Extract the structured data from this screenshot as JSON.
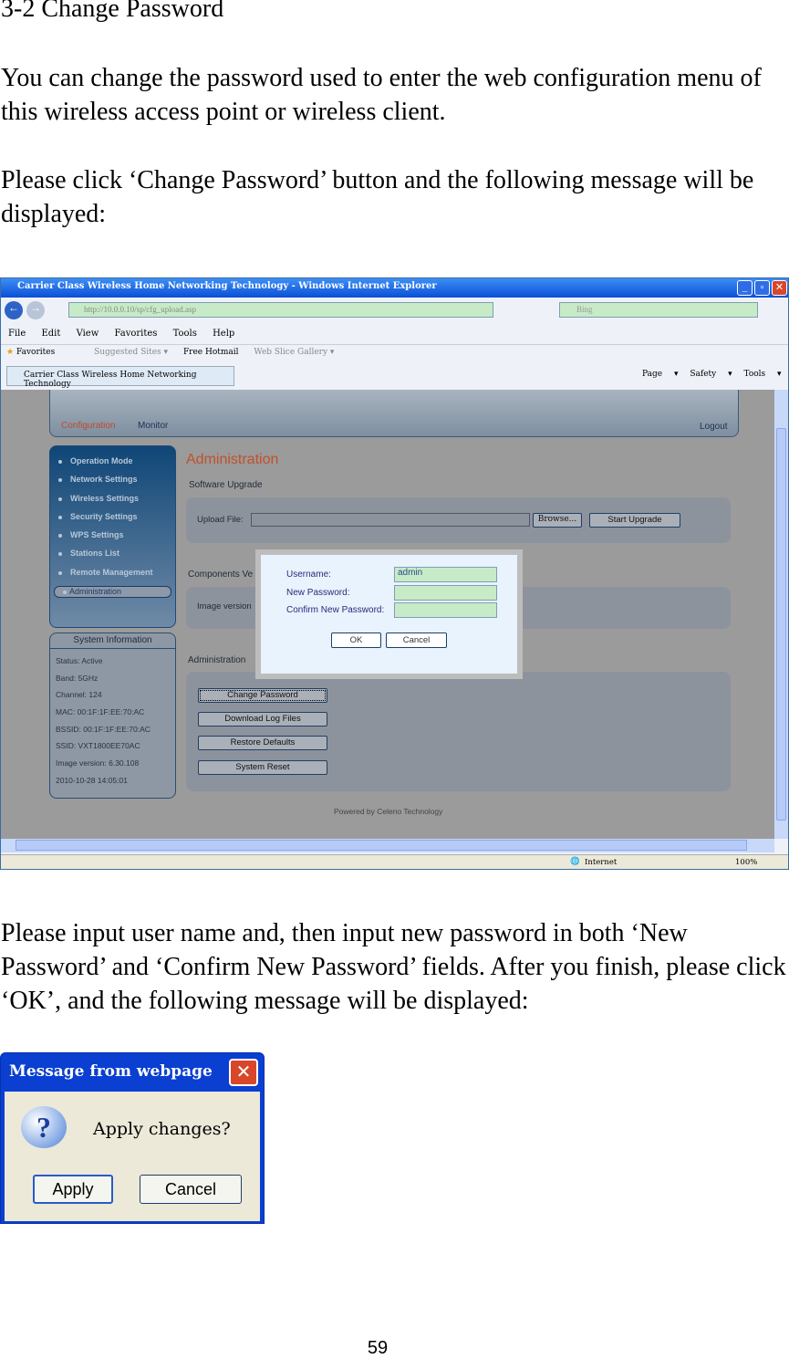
{
  "doc": {
    "heading": "3-2 Change Password",
    "para1": "You can change the password used to enter the web configuration menu of this wireless access point or wireless client.",
    "para2": "Please click ‘Change Password’ button and the following message will be displayed:",
    "para3": "Please input user name and, then input new password in both ‘New Password’ and ‘Confirm New Password’ fields. After you finish, please click ‘OK’, and the following message will be displayed:",
    "page_number": "59"
  },
  "browser": {
    "title": "Carrier Class Wireless Home Networking Technology - Windows Internet Explorer",
    "url": "http://10.0.0.10/sp/cfg_upload.asp",
    "search_placeholder": "Bing",
    "menu": [
      "File",
      "Edit",
      "View",
      "Favorites",
      "Tools",
      "Help"
    ],
    "favorites": {
      "label": "Favorites",
      "items": [
        "Suggested Sites ▾",
        "Free Hotmail",
        "Web Slice Gallery ▾"
      ]
    },
    "tab": "Carrier Class Wireless Home Networking Technology",
    "cmd": [
      "Page ▾",
      "Safety ▾",
      "Tools ▾"
    ],
    "status": {
      "zone": "Internet",
      "zoom": "100%"
    }
  },
  "app": {
    "top_nav": [
      "Configuration",
      "Monitor"
    ],
    "logout": "Logout",
    "sidebar": [
      "Operation Mode",
      "Network Settings",
      "Wireless Settings",
      "Security Settings",
      "WPS Settings",
      "Stations List",
      "Remote Management",
      "Administration"
    ],
    "sysinfo": {
      "title": "System Information",
      "lines": [
        "Status: Active",
        "Band: 5GHz",
        "Channel: 124",
        "MAC: 00:1F:1F:EE:70:AC",
        "BSSID: 00:1F:1F:EE:70:AC",
        "SSID: VXT1800EE70AC",
        "Image version: 6.30.108",
        "2010-10-28 14:05:01"
      ]
    },
    "page_title": "Administration",
    "software_upgrade": {
      "title": "Software Upgrade",
      "upload_label": "Upload File:",
      "browse": "Browse...",
      "start": "Start Upgrade"
    },
    "components": {
      "title": "Components Ve",
      "image_version": "Image version"
    },
    "admin": {
      "title": "Administration",
      "buttons": [
        "Change Password",
        "Download Log Files",
        "Restore Defaults",
        "System Reset"
      ]
    },
    "footer": "Powered by Celeno Technology",
    "modal": {
      "username_label": "Username:",
      "username_value": "admin",
      "new_label": "New Password:",
      "confirm_label": "Confirm New Password:",
      "ok": "OK",
      "cancel": "Cancel"
    }
  },
  "message": {
    "title": "Message from webpage",
    "text": "Apply changes?",
    "apply": "Apply",
    "cancel": "Cancel",
    "icon": "question-icon"
  }
}
